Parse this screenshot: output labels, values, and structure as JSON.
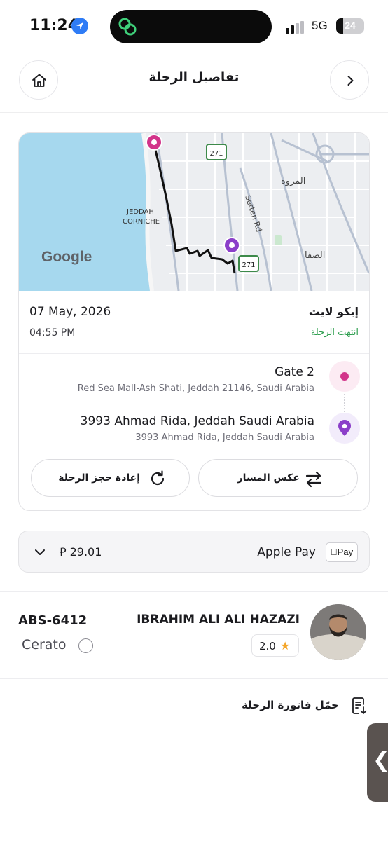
{
  "status_bar": {
    "time": "11:24",
    "network": "5G",
    "battery": "24"
  },
  "header": {
    "title": "تفاصيل الرحلة"
  },
  "trip": {
    "date": "07 May, 2026",
    "time": "04:55 PM",
    "service": "إيكو لايت",
    "status": "انتهت الرحلة",
    "status_color": "#2e9e4f",
    "pickup": {
      "title": "Gate 2",
      "address": "Red Sea Mall-Ash Shati, Jeddah 21146, Saudi Arabia"
    },
    "destination": {
      "title": "3993 Ahmad Rida, Jeddah Saudi Arabia",
      "address": "3993 Ahmad Rida, Jeddah Saudi Arabia"
    },
    "rebook_label": "إعادة حجز الرحلة",
    "reverse_label": "عكس المسار"
  },
  "map": {
    "labels": {
      "corniche": "JEDDAH\nCORNICHE",
      "corniche_line1": "JEDDAH",
      "corniche_line2": "CORNICHE",
      "marwah": "المروة",
      "safa": "الصفا",
      "setten": "Setten Rd",
      "route_271": "271",
      "google": "Google"
    },
    "pickup_color": "#d2348a",
    "destination_color": "#8b3fc9",
    "water_color": "#a6d8ee",
    "land_color": "#eceef1"
  },
  "payment": {
    "method": "Apple Pay",
    "badge": "Pay",
    "amount": "29.01",
    "currency_symbol": "⃁"
  },
  "driver": {
    "plate": "ABS-6412",
    "car": "Cerato",
    "name": "IBRAHIM ALI ALI HAZAZI",
    "rating": "2.0"
  },
  "invoice": {
    "label": "حمّل فاتورة الرحلة"
  },
  "colors": {
    "accent_pink": "#d2348a",
    "accent_purple": "#8b3fc9",
    "star": "#f4a62a"
  }
}
